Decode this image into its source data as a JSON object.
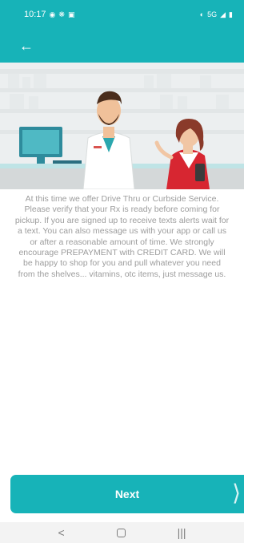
{
  "status_bar": {
    "time": "10:17",
    "left_icons": [
      "chat-bubble-icon",
      "settings-icon",
      "image-icon"
    ],
    "network": "5G",
    "right_icons": [
      "alarm-icon",
      "signal-icon",
      "battery-icon"
    ]
  },
  "app_bar": {
    "back_icon": "arrow-left-icon"
  },
  "hero": {
    "illustration": "pharmacist-and-customer"
  },
  "message": {
    "text": "At this time we offer Drive Thru or Curbside Service. Please verify that your Rx is ready before coming for pickup. If you are signed up to receive texts alerts wait for a text. You can also message us with your app or call us or after a reasonable amount of time. We strongly encourage PREPAYMENT with CREDIT CARD. We will be happy to shop for you and pull whatever you need from the shelves... vitamins, otc items, just message us."
  },
  "next_button": {
    "label": "Next"
  },
  "colors": {
    "brand_teal": "#17b3b8",
    "text_gray": "#9c9c9c",
    "nav_bar": "#f3f3f3"
  },
  "nav_bar": {
    "back_icon": "nav-back-icon",
    "home_icon": "nav-home-icon",
    "recents_icon": "nav-recents-icon"
  }
}
